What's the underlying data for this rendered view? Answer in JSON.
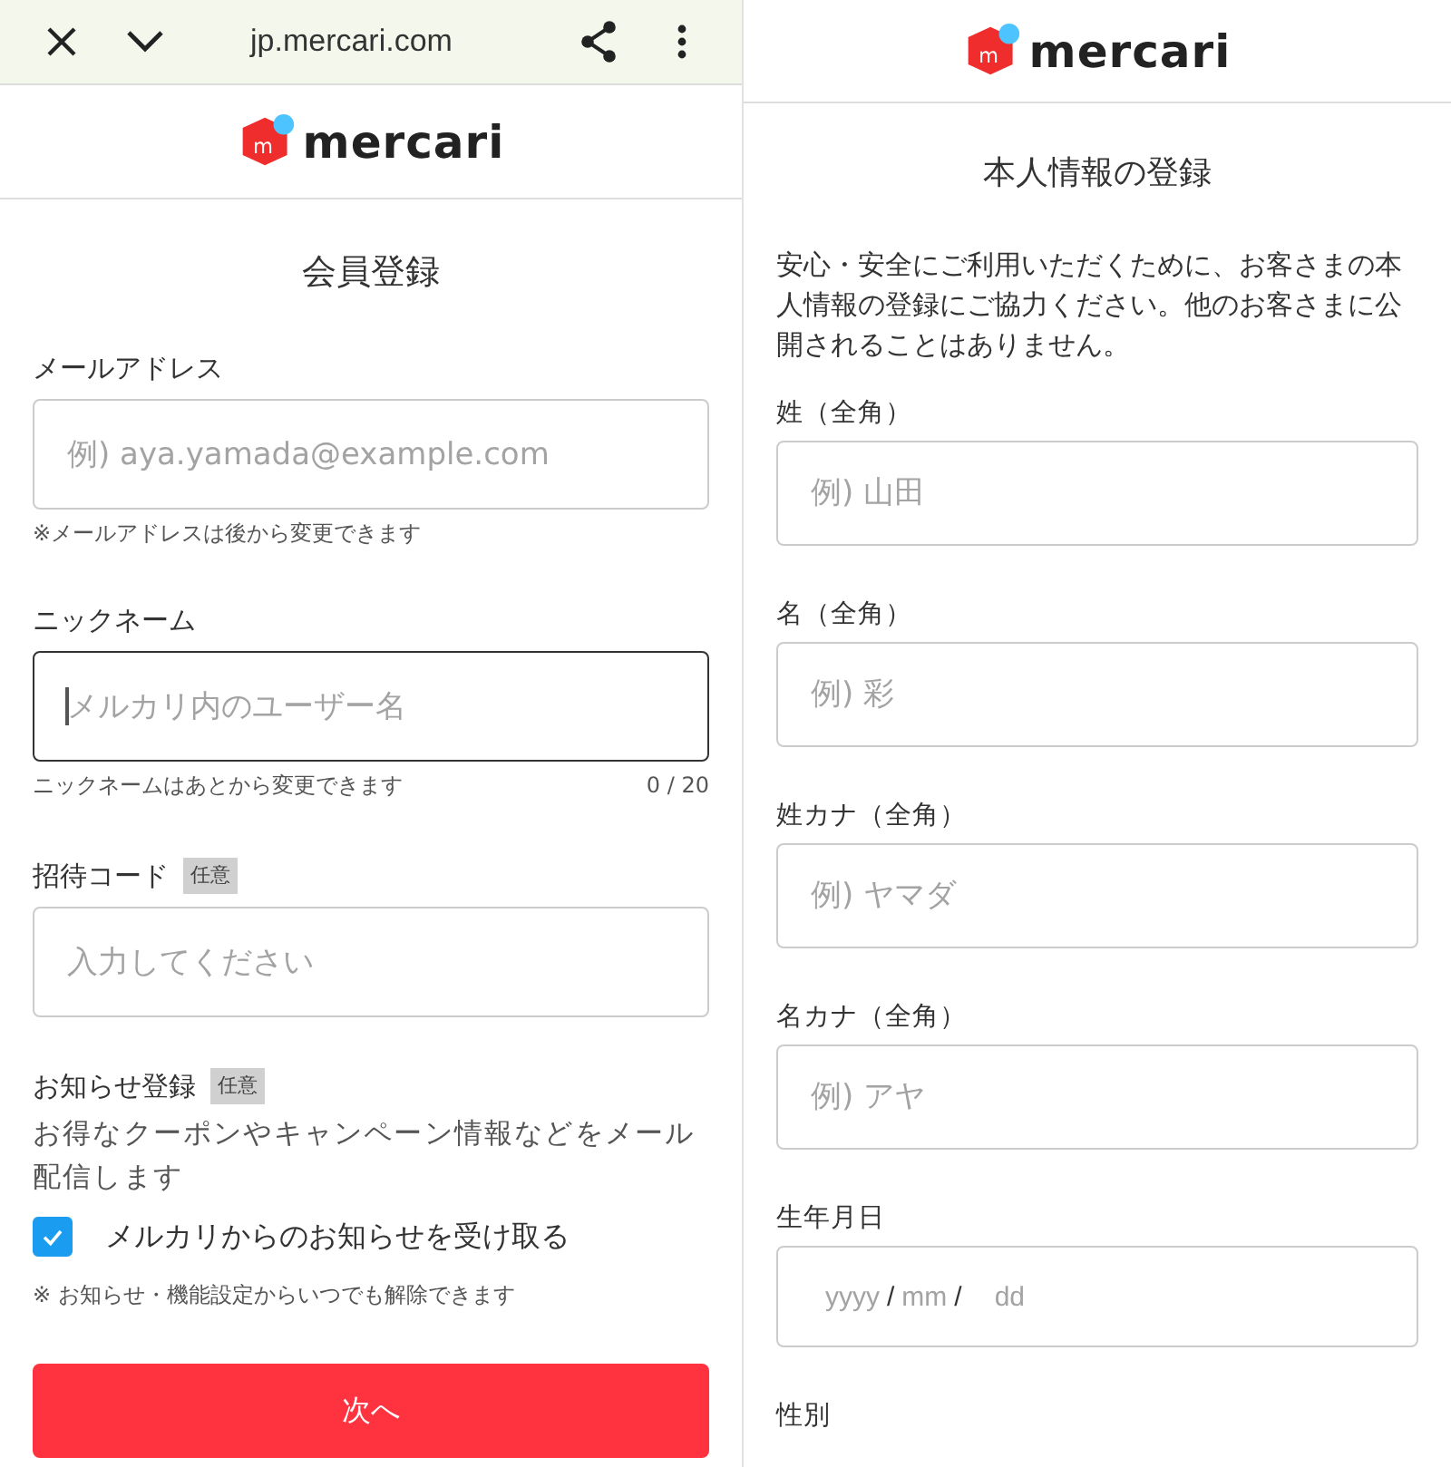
{
  "left_screen": {
    "browser_bar": {
      "url": "jp.mercari.com"
    },
    "logo": {
      "mark": "m",
      "wordmark": "mercari"
    },
    "title": "会員登録",
    "fields": [
      {
        "label": "メールアドレス",
        "placeholder": "例) aya.yamada@example.com",
        "hint": "※メールアドレスは後から変更できます",
        "focused": false
      },
      {
        "label": "ニックネーム",
        "placeholder": "メルカリ内のユーザー名",
        "hint": "ニックネームはあとから変更できます",
        "counter": "0 / 20",
        "focused": true
      },
      {
        "label": "招待コード",
        "badge": "任意",
        "placeholder": "入力してください",
        "focused": false
      }
    ],
    "newsletter": {
      "label": "お知らせ登録",
      "badge": "任意",
      "description": "お得なクーポンやキャンペーン情報などをメール配信します",
      "checkbox": {
        "label": "メルカリからのお知らせを受け取る",
        "checked": true
      },
      "note": "※ お知らせ・機能設定からいつでも解除できます"
    },
    "next_button": "次へ"
  },
  "right_screen": {
    "logo": {
      "mark": "m",
      "wordmark": "mercari"
    },
    "title": "本人情報の登録",
    "intro": "安心・安全にご利用いただくために、お客さまの本人情報の登録にご協力ください。他のお客さまに公開されることはありません。",
    "fields": [
      {
        "kind": "text",
        "label": "姓（全角）",
        "placeholder": "例) 山田"
      },
      {
        "kind": "text",
        "label": "名（全角）",
        "placeholder": "例) 彩"
      },
      {
        "kind": "text",
        "label": "姓カナ（全角）",
        "placeholder": "例) ヤマダ"
      },
      {
        "kind": "text",
        "label": "名カナ（全角）",
        "placeholder": "例) アヤ"
      },
      {
        "kind": "date",
        "label": "生年月日",
        "segments": [
          "yyyy",
          "/",
          "mm",
          "/",
          "dd"
        ]
      },
      {
        "kind": "section",
        "label": "性別"
      }
    ]
  }
}
